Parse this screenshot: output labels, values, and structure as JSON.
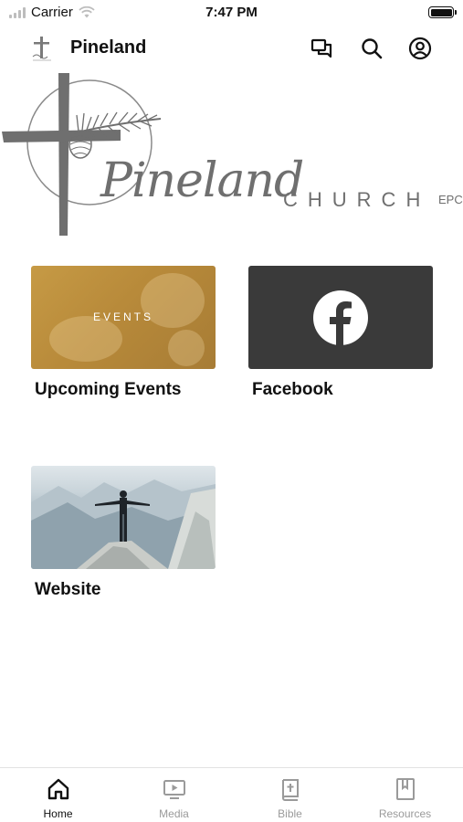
{
  "status_bar": {
    "carrier": "Carrier",
    "time": "7:47 PM"
  },
  "nav": {
    "title": "Pineland",
    "logo_text": "Pineland"
  },
  "hero": {
    "name": "Pineland",
    "church": "CHURCH",
    "suffix": "EPC"
  },
  "tiles": [
    {
      "label": "Upcoming Events",
      "image_text": "EVENTS"
    },
    {
      "label": "Facebook",
      "image_text": ""
    },
    {
      "label": "Website",
      "image_text": ""
    }
  ],
  "tab_bar": {
    "items": [
      {
        "label": "Home",
        "icon": "home-icon",
        "active": true
      },
      {
        "label": "Media",
        "icon": "media-icon",
        "active": false
      },
      {
        "label": "Bible",
        "icon": "bible-icon",
        "active": false
      },
      {
        "label": "Resources",
        "icon": "bookmark-icon",
        "active": false
      }
    ]
  },
  "colors": {
    "accent": "#111111",
    "inactive": "#9a9a9a",
    "logo_gray": "#6f6f6f",
    "facebook_tile": "#3a3a3a",
    "events_tile": "#c69a45"
  }
}
